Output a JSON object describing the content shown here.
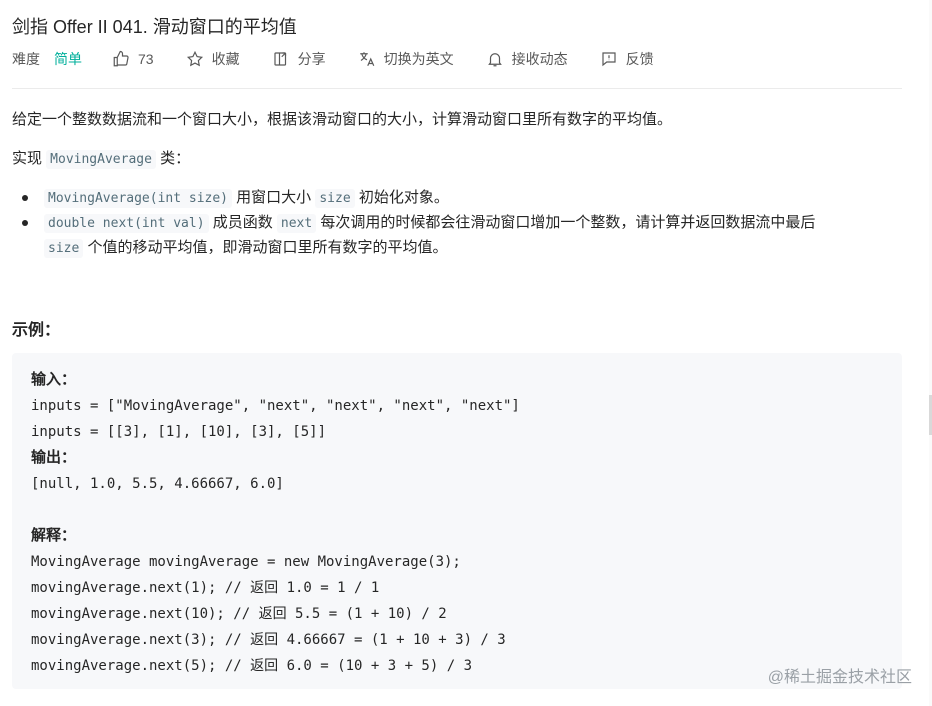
{
  "title": "剑指 Offer II 041. 滑动窗口的平均值",
  "meta": {
    "difficulty_label": "难度",
    "difficulty_value": "简单",
    "likes": "73",
    "collect": "收藏",
    "share": "分享",
    "switch_lang": "切换为英文",
    "subscribe": "接收动态",
    "feedback": "反馈"
  },
  "colors": {
    "difficulty_easy": "#00af9b",
    "code_bg": "#f7f8fa",
    "example_bg": "#f7f8fa"
  },
  "icons": [
    "thumb-up-icon",
    "star-icon",
    "share-icon",
    "translate-icon",
    "bell-icon",
    "feedback-icon"
  ],
  "description": "给定一个整数数据流和一个窗口大小，根据该滑动窗口的大小，计算滑动窗口里所有数字的平均值。",
  "impl": {
    "prefix": "实现 ",
    "code": "MovingAverage",
    "suffix": " 类："
  },
  "bullets": [
    {
      "code1": "MovingAverage(int size)",
      "text1": " 用窗口大小 ",
      "code2": "size",
      "text2": " 初始化对象。"
    },
    {
      "code1": "double next(int val)",
      "text1": " 成员函数 ",
      "code2": "next",
      "text2": " 每次调用的时候都会往滑动窗口增加一个整数，请计算并返回数据流中最后",
      "code3": "size",
      "text3": " 个值的移动平均值，即滑动窗口里所有数字的平均值。"
    }
  ],
  "example": {
    "heading": "示例：",
    "input_label": "输入：",
    "input_line1": "inputs = [\"MovingAverage\", \"next\", \"next\", \"next\", \"next\"]",
    "input_line2": "inputs = [[3], [1], [10], [3], [5]]",
    "output_label": "输出：",
    "output_line": "[null, 1.0, 5.5, 4.66667, 6.0]",
    "explain_label": "解释：",
    "explain_lines": [
      "MovingAverage movingAverage = new MovingAverage(3);",
      "movingAverage.next(1); // 返回 1.0 = 1 / 1",
      "movingAverage.next(10); // 返回 5.5 = (1 + 10) / 2",
      "movingAverage.next(3); // 返回 4.66667 = (1 + 10 + 3) / 3",
      "movingAverage.next(5); // 返回 6.0 = (10 + 3 + 5) / 3"
    ]
  },
  "watermark": "@稀土掘金技术社区"
}
